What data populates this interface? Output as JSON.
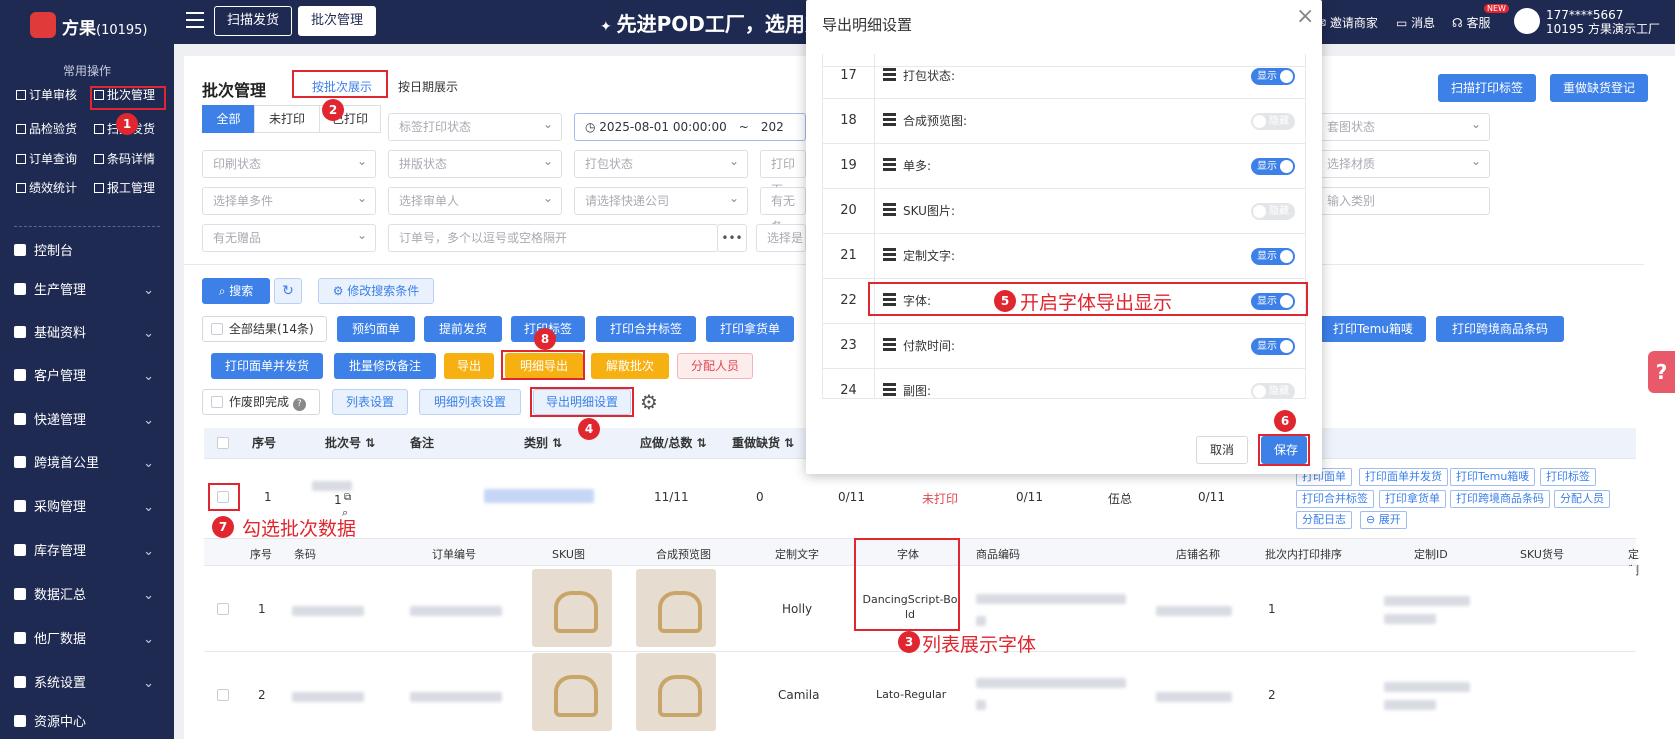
{
  "app": {
    "name": "方果",
    "tenant_id": "(10195)"
  },
  "sidebar": {
    "section_title": "常用操作",
    "quick_items": [
      "订单审核",
      "批次管理",
      "品检验货",
      "扫描发货",
      "订单查询",
      "条码详情",
      "绩效统计",
      "报工管理"
    ],
    "menu": [
      "控制台",
      "生产管理",
      "基础资料",
      "客户管理",
      "快递管理",
      "跨境首公里",
      "采购管理",
      "库存管理",
      "数据汇总",
      "他厂数据",
      "系统设置",
      "资源中心"
    ]
  },
  "topbar": {
    "tabs": [
      "扫描发货",
      "批次管理"
    ],
    "banner": "先进POD工厂，选用方",
    "invite": "邀请商家",
    "messages": "消息",
    "service": "客服",
    "new_badge": "NEW",
    "user_phone": "177****5667",
    "user_org": "10195 方果演示工厂"
  },
  "page": {
    "title": "批次管理",
    "view_by_batch": "按批次展示",
    "view_by_date": "按日期展示",
    "scan_print_label": "扫描打印标签",
    "redo_register": "重做缺货登记"
  },
  "filters": {
    "seg": [
      "全部",
      "未打印",
      "已打印"
    ],
    "label_print_status": "标签打印状态",
    "date_start": "2025-08-01 00:00:00",
    "date_sep": "~",
    "date_end_partial": "202",
    "set_image_status": "套图状态",
    "print_status": "印刷状态",
    "layout_status": "拼版状态",
    "pack_status": "打包状态",
    "print_face": "打印面",
    "select_material": "选择材质",
    "select_single_multi": "选择单多件",
    "select_reviewer": "选择审单人",
    "select_express": "请选择快递公司",
    "has_note": "有无备",
    "input_category": "输入类别",
    "has_gift": "有无赠品",
    "order_search": "订单号，多个以逗号或空格隔开",
    "ellipsis": "•••",
    "select_yes": "选择是"
  },
  "toolbar": {
    "search": "搜索",
    "modify_conditions": "修改搜索条件",
    "all_results": "全部结果(14条)",
    "reserve_face": "预约面单",
    "advance_ship": "提前发货",
    "print_label": "打印标签",
    "print_merged_label": "打印合并标签",
    "print_pick": "打印拿货单",
    "print_temu_box": "打印Temu箱唛",
    "print_cross_barcode": "打印跨境商品条码",
    "print_face_ship": "打印面单并发货",
    "batch_modify_note": "批量修改备注",
    "export": "导出",
    "detail_export": "明细导出",
    "dissolve_batch": "解散批次",
    "assign_person": "分配人员",
    "complete_on_void": "作废即完成",
    "list_settings": "列表设置",
    "detail_list_settings": "明细列表设置",
    "export_detail_settings": "导出明细设置"
  },
  "batch_table": {
    "headers": [
      "序号",
      "批次号",
      "备注",
      "类别",
      "应做/总数",
      "重做缺货"
    ],
    "row": {
      "seq": "1",
      "batch_suffix": "1",
      "ratio": "11/11",
      "redo": "0",
      "c1": "0/11",
      "status": "未打印",
      "c2": "0/11",
      "c3": "伍总",
      "c4": "0/11"
    },
    "row_actions": [
      "打印面单",
      "打印面单并发货",
      "打印Temu箱唛",
      "打印标签",
      "打印合并标签",
      "打印拿货单",
      "打印跨境商品条码",
      "分配人员",
      "分配日志",
      "展开"
    ]
  },
  "detail_table": {
    "headers": [
      "序号",
      "条码",
      "订单编号",
      "SKU图",
      "合成预览图",
      "定制文字",
      "字体",
      "商品编码",
      "店铺名称",
      "批次内打印排序",
      "定制ID",
      "SKU货号",
      "定制"
    ],
    "rows": [
      {
        "seq": "1",
        "text": "Holly",
        "font": "DancingScript-Bold",
        "order_in_batch": "1"
      },
      {
        "seq": "2",
        "text": "Camila",
        "font": "Lato-Regular",
        "order_in_batch": "2"
      }
    ]
  },
  "modal": {
    "title": "导出明细设置",
    "rows": [
      {
        "num": "17",
        "label": "打包状态:",
        "switch": "显示",
        "on": true
      },
      {
        "num": "18",
        "label": "合成预览图:",
        "switch": "隐藏",
        "on": false
      },
      {
        "num": "19",
        "label": "单多:",
        "switch": "显示",
        "on": true
      },
      {
        "num": "20",
        "label": "SKU图片:",
        "switch": "隐藏",
        "on": false
      },
      {
        "num": "21",
        "label": "定制文字:",
        "switch": "显示",
        "on": true
      },
      {
        "num": "22",
        "label": "字体:",
        "switch": "显示",
        "on": true
      },
      {
        "num": "23",
        "label": "付款时间:",
        "switch": "显示",
        "on": true
      },
      {
        "num": "24",
        "label": "副图:",
        "switch": "隐藏",
        "on": false
      }
    ],
    "cancel": "取消",
    "save": "保存"
  },
  "annotations": {
    "n1": "1",
    "n2": "2",
    "n3": "3",
    "n4": "4",
    "n5": "5",
    "n6": "6",
    "n7": "7",
    "n8": "8",
    "t3": "列表展示字体",
    "t5": "开启字体导出显示",
    "t7": "勾选批次数据"
  },
  "help": {
    "glyph": "?"
  },
  "colors": {
    "primary": "#3c80e8",
    "sidebar": "#1f2a52",
    "annotation": "#e0262f"
  }
}
